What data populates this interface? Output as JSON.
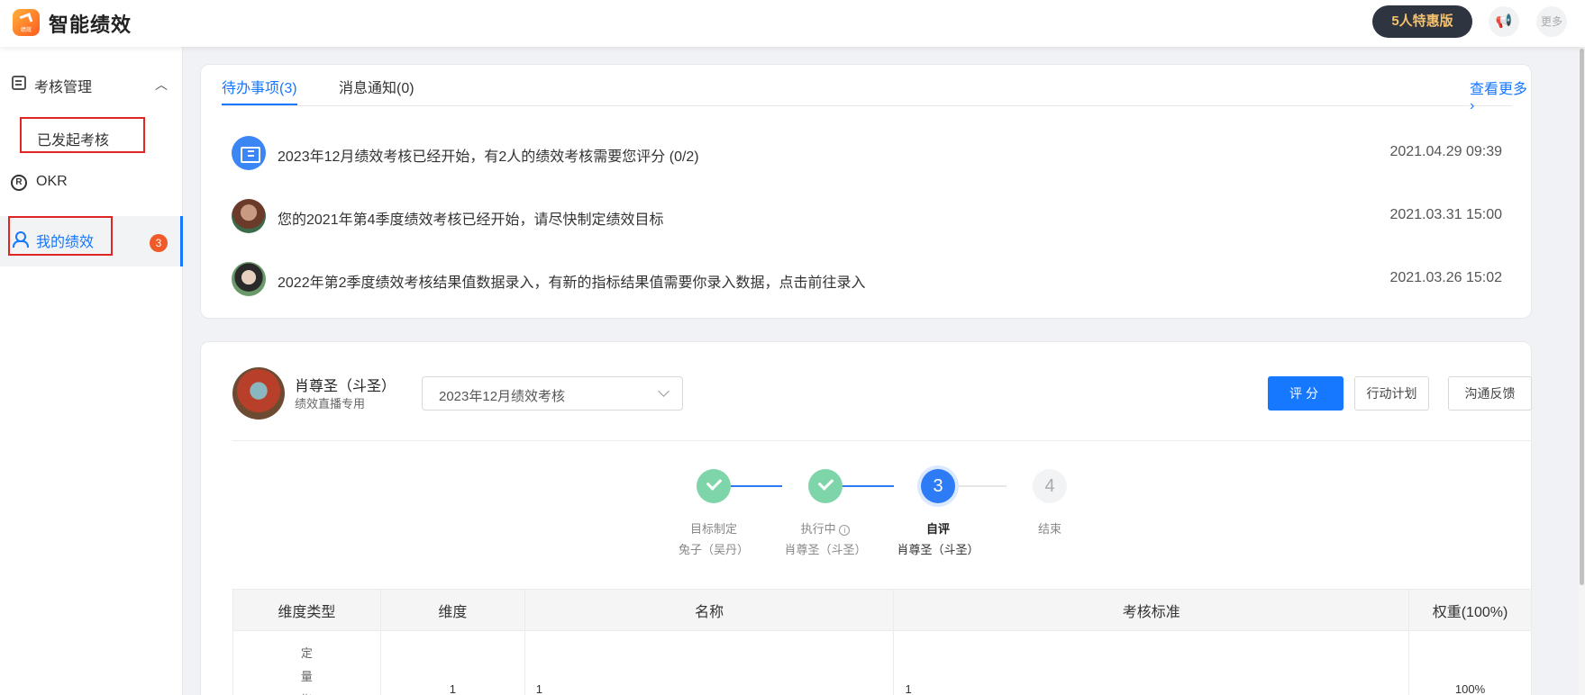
{
  "app": {
    "title": "智能绩效",
    "logo_text": "绩效",
    "promo_label": "5人特惠版",
    "more_label": "更多",
    "megaphone_icon": "megaphone-icon"
  },
  "sidebar": {
    "group_label": "考核管理",
    "sub_item_label": "已发起考核",
    "okr_label": "OKR",
    "okr_icon_text": "R",
    "mine_label": "我的绩效",
    "mine_badge": "3"
  },
  "todo": {
    "tabs": [
      {
        "label": "待办事项(3)",
        "active": true
      },
      {
        "label": "消息通知(0)",
        "active": false
      }
    ],
    "see_more": "查看更多",
    "items": [
      {
        "text": "2023年12月绩效考核已经开始，有2人的绩效考核需要您评分 (0/2)",
        "time": "2021.04.29 09:39",
        "icon": "task-list-icon"
      },
      {
        "text": "您的2021年第4季度绩效考核已经开始，请尽快制定绩效目标",
        "time": "2021.03.31 15:00",
        "icon": "avatar"
      },
      {
        "text": "2022年第2季度绩效考核结果值数据录入，有新的指标结果值需要你录入数据，点击前往录入",
        "time": "2021.03.26 15:02",
        "icon": "avatar"
      }
    ]
  },
  "perf": {
    "name": "肖尊圣（斗圣）",
    "subtitle": "绩效直播专用",
    "period": "2023年12月绩效考核",
    "buttons": {
      "score": "评分",
      "action_plan": "行动计划",
      "feedback": "沟通反馈"
    },
    "steps": [
      {
        "title": "目标制定",
        "person": "兔子（吴丹）",
        "status": "done",
        "num": ""
      },
      {
        "title": "执行中",
        "person": "肖尊圣（斗圣）",
        "status": "done",
        "num": "",
        "info": "i"
      },
      {
        "title": "自评",
        "person": "肖尊圣（斗圣）",
        "status": "current",
        "num": "3"
      },
      {
        "title": "结束",
        "person": "",
        "status": "todo",
        "num": "4"
      }
    ],
    "table": {
      "headers": [
        "维度类型",
        "维度",
        "名称",
        "考核标准",
        "权重(100%)"
      ],
      "rows": [
        {
          "type": "定量指",
          "dimension": "1",
          "name": "1",
          "standard": "1",
          "weight": "100%"
        }
      ]
    }
  },
  "colors": {
    "primary": "#1677ff",
    "badge": "#f05a28",
    "step_done": "#7fd5aa",
    "highlight_box": "#e02525"
  }
}
